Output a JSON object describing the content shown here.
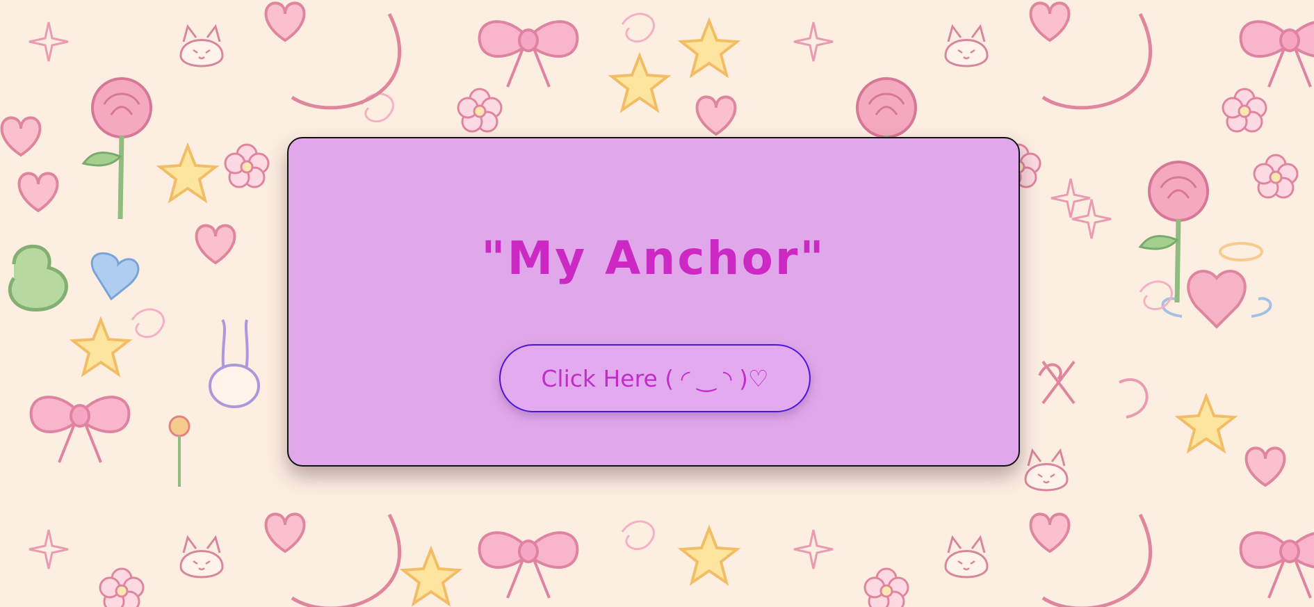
{
  "background": {
    "color": "#fdeee2",
    "pattern": "kawaii doodle wallpaper: bows, hearts, stars, flowers, cats, bunnies, sparkles"
  },
  "card": {
    "title": "\"My Anchor\"",
    "background_color": "#e0a8ea",
    "title_color": "#cc29c4",
    "button": {
      "label": "Click Here ( ◜ ‿ ◝ )♡",
      "border_color": "#4a16d8",
      "text_color": "#c12ccb"
    }
  }
}
